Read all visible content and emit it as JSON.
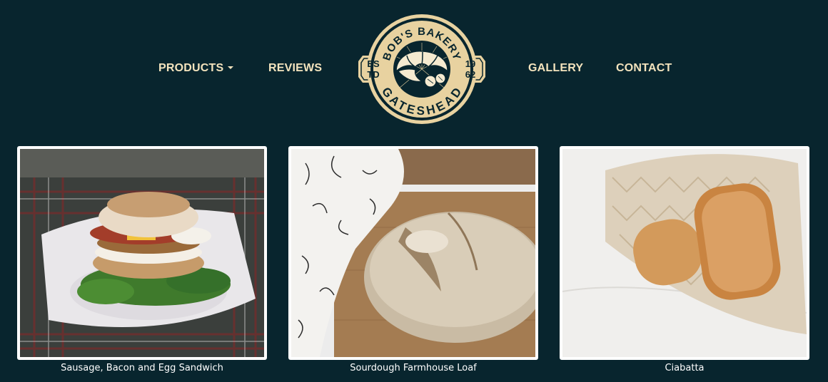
{
  "nav": {
    "products": "PRODUCTS",
    "reviews": "REVIEWS",
    "gallery": "GALLERY",
    "contact": "CONTACT"
  },
  "logo": {
    "top_text": "BOB'S BAKERY",
    "bottom_text": "GATESHEAD",
    "left_top": "ES",
    "left_bottom": "TD",
    "right_top": "19",
    "right_bottom": "62"
  },
  "products": [
    {
      "caption": "Sausage, Bacon and Egg Sandwich",
      "image": "sausage-bacon-egg-sandwich-photo"
    },
    {
      "caption": "Sourdough Farmhouse Loaf",
      "image": "sourdough-farmhouse-loaf-photo"
    },
    {
      "caption": "Ciabatta",
      "image": "ciabatta-photo"
    }
  ],
  "colors": {
    "background": "#08252e",
    "nav_text": "#f3e3bd",
    "logo_gold": "#e8d2a0"
  }
}
